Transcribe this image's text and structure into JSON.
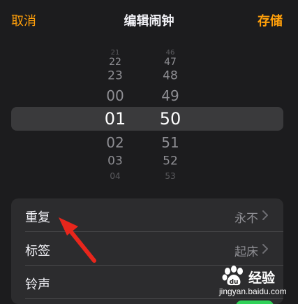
{
  "nav": {
    "cancel_label": "取消",
    "title": "编辑闹钟",
    "save_label": "存储"
  },
  "picker": {
    "hours": [
      "21",
      "22",
      "23",
      "00",
      "01",
      "02",
      "03",
      "04"
    ],
    "minutes": [
      "46",
      "47",
      "48",
      "49",
      "50",
      "51",
      "52",
      "53"
    ],
    "selected_hour": "01",
    "selected_minute": "50"
  },
  "settings": {
    "rows": [
      {
        "label": "重复",
        "value": "永不"
      },
      {
        "label": "标签",
        "value": "起床"
      },
      {
        "label": "铃声",
        "value": ""
      }
    ],
    "snooze_toggle_on": true
  },
  "watermark": {
    "brand": "经验",
    "url": "jingyan.baidu.com",
    "logo": "baidu-paw-icon"
  },
  "colors": {
    "accent": "#ff9f0a",
    "background": "#1c1c1e",
    "card": "#2c2c2e",
    "toggle_on": "#30d158",
    "annotation_arrow": "#e8261c"
  }
}
